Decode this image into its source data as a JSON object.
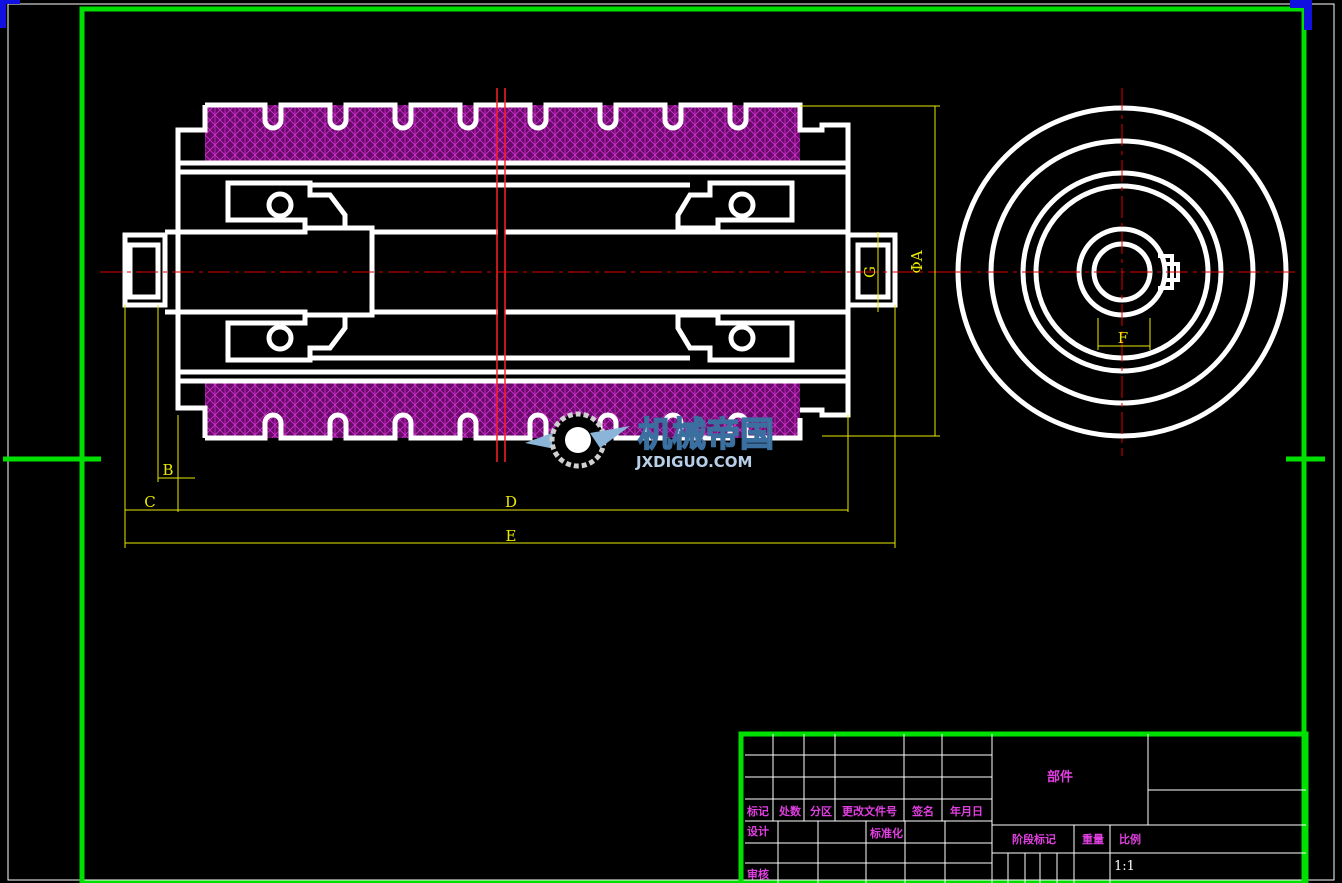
{
  "drawing": {
    "dimensions": {
      "B": "B",
      "C": "C",
      "D": "D",
      "E": "E",
      "F": "F",
      "G": "G",
      "phiA": "ΦA"
    },
    "watermark": {
      "cn": "机械帝国",
      "en": "JXDIGUO.COM"
    }
  },
  "title_block": {
    "name": "部件",
    "scale_value": "1:1",
    "labels": {
      "mark": "标记",
      "count": "处数",
      "zone": "分区",
      "change_doc": "更改文件号",
      "signature": "签名",
      "date": "年月日",
      "design": "设计",
      "standardize": "标准化",
      "stage_mark": "阶段标记",
      "weight": "重量",
      "scale": "比例",
      "review": "审核"
    }
  },
  "colors": {
    "frame": "#00e000",
    "outline": "#ffffff",
    "hatch": "#c020c0",
    "dimension": "#e8e800",
    "centerline": "#e00000",
    "corner": "#1010e0",
    "title_text": "#e040e0"
  }
}
